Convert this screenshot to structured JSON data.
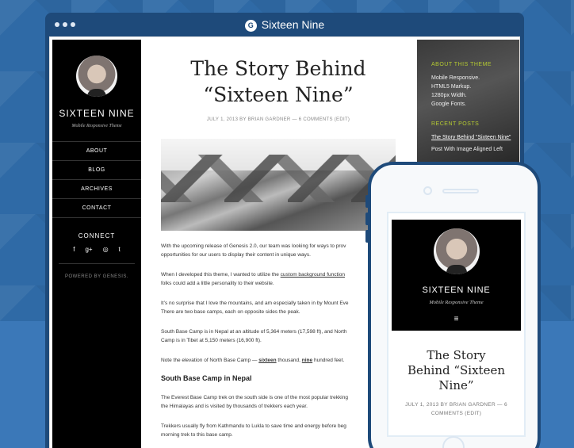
{
  "browser": {
    "logo": "G",
    "title": "Sixteen Nine"
  },
  "sidebar_left": {
    "site_title": "SIXTEEN NINE",
    "site_description": "Mobile Responsive Theme",
    "nav": [
      "ABOUT",
      "BLOG",
      "ARCHIVES",
      "CONTACT"
    ],
    "connect_title": "CONNECT",
    "social": [
      "f",
      "g+",
      "◎",
      "t"
    ],
    "powered": "POWERED BY GENESIS."
  },
  "post": {
    "title_line1": "The Story Behind",
    "title_line2": "“Sixteen Nine”",
    "meta": "JULY 1, 2013 BY BRIAN GARDNER — 6 COMMENTS (EDIT)",
    "p1_line1": "With the upcoming release of Genesis 2.0, our team was looking for ways to prov",
    "p1_line2": "opportunities for our users to display their content in unique ways.",
    "p2_line1_prefix": "When I developed this theme, I wanted to utilize the ",
    "p2_link": "custom background function",
    "p2_line2": "folks could add a little personality to their website.",
    "p3_line1": "It’s no surprise that I love the mountains, and am especially taken in by Mount Eve",
    "p3_line2": "There are two base camps, each on opposite sides the peak.",
    "p4_line1": "South Base Camp is in Nepal at an altitude of 5,364 meters (17,598 ft), and North",
    "p4_line2": "Camp is in Tibet at 5,150 meters (16,900 ft).",
    "p5_prefix": "Note the elevation of North Base Camp — ",
    "p5_bold1": "sixteen",
    "p5_mid": " thousand, ",
    "p5_bold2": "nine",
    "p5_suffix": " hundred feet.",
    "subheading": "South Base Camp in Nepal",
    "p6_line1": "The Everest Base Camp trek on the south side is one of the most popular trekking",
    "p6_line2": "the Himalayas and is visited by thousands of trekkers each year.",
    "p7_line1": "Trekkers usually fly from Kathmandu to Lukla to save time and energy before beg",
    "p7_line2": "morning trek to this base camp."
  },
  "sidebar_right": {
    "about_title": "ABOUT THIS THEME",
    "about_items": [
      "Mobile Responsive.",
      "HTML5 Markup.",
      "1280px Width.",
      "Google Fonts."
    ],
    "recent_title": "RECENT POSTS",
    "recent_items": [
      "The Story Behind “Sixteen Nine”",
      "Post With Image Aligned Left"
    ]
  },
  "mobile": {
    "site_title": "SIXTEEN NINE",
    "site_description": "Mobile Responsive Theme",
    "menu_icon": "≡",
    "post_title_line1": "The Story",
    "post_title_line2": "Behind “Sixteen",
    "post_title_line3": "Nine”",
    "meta_line1": "JULY 1, 2013 BY BRIAN GARDNER — 6",
    "meta_line2": "COMMENTS (EDIT)"
  }
}
